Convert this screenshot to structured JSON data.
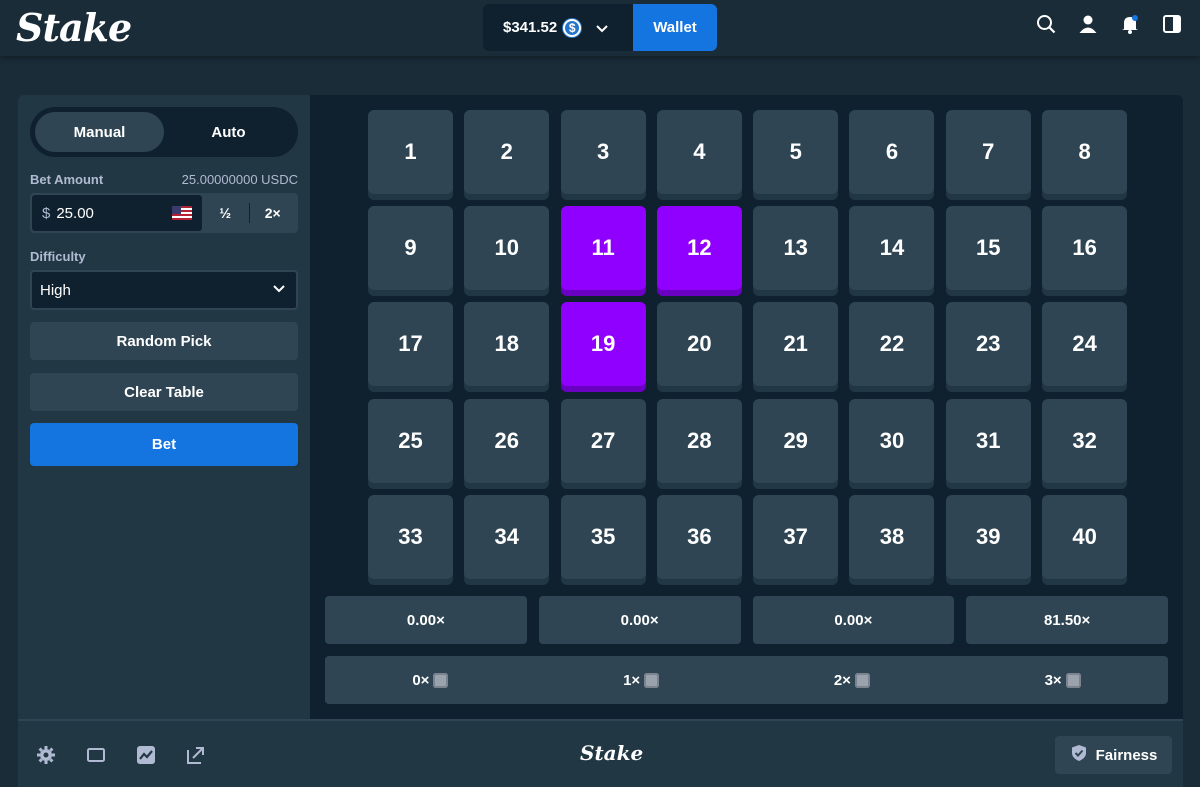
{
  "header": {
    "logo": "Stake",
    "balance": "$341.52",
    "coin_symbol": "$",
    "wallet_label": "Wallet"
  },
  "sidebar": {
    "tabs": [
      {
        "label": "Manual",
        "active": true
      },
      {
        "label": "Auto",
        "active": false
      }
    ],
    "bet_amount_label": "Bet Amount",
    "bet_amount_crypto": "25.00000000 USDC",
    "bet_currency": "$",
    "bet_value": "25.00",
    "half_label": "½",
    "double_label": "2×",
    "difficulty_label": "Difficulty",
    "difficulty_value": "High",
    "random_pick_label": "Random Pick",
    "clear_table_label": "Clear Table",
    "bet_label": "Bet"
  },
  "board": {
    "tiles": [
      "1",
      "2",
      "3",
      "4",
      "5",
      "6",
      "7",
      "8",
      "9",
      "10",
      "11",
      "12",
      "13",
      "14",
      "15",
      "16",
      "17",
      "18",
      "19",
      "20",
      "21",
      "22",
      "23",
      "24",
      "25",
      "26",
      "27",
      "28",
      "29",
      "30",
      "31",
      "32",
      "33",
      "34",
      "35",
      "36",
      "37",
      "38",
      "39",
      "40"
    ],
    "selected": [
      "11",
      "12",
      "19"
    ],
    "payouts": [
      "0.00×",
      "0.00×",
      "0.00×",
      "81.50×"
    ],
    "hits": [
      "0×",
      "1×",
      "2×",
      "3×"
    ]
  },
  "footer": {
    "logo": "Stake",
    "fairness_label": "Fairness"
  },
  "colors": {
    "background": "#1a2c38",
    "panel": "#213743",
    "tile": "#2f4553",
    "selected_tile": "#9000ff",
    "accent_blue": "#1475e1"
  }
}
